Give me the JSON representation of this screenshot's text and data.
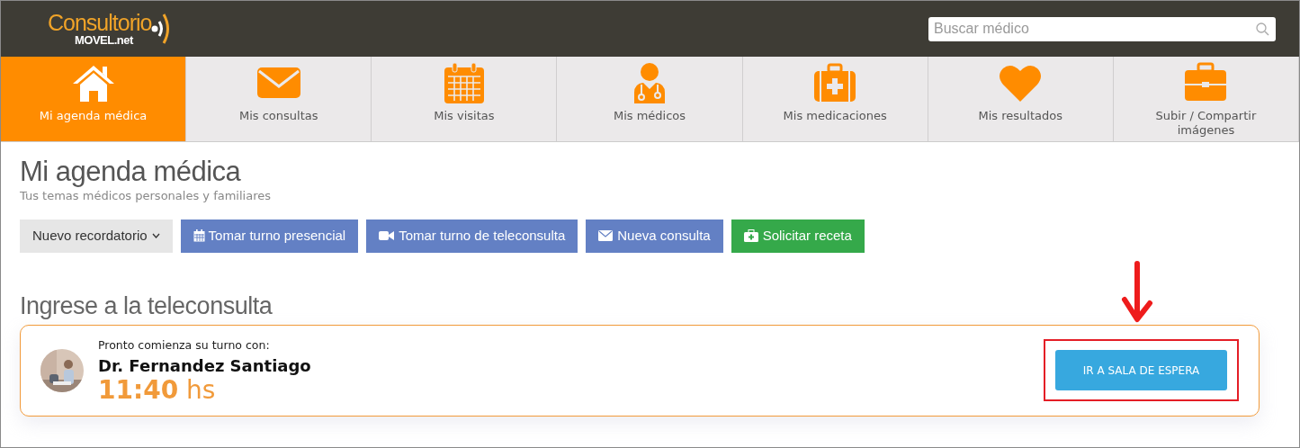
{
  "header": {
    "logo": {
      "name": "Consultorio",
      "domain": "MOVEL.net"
    },
    "search": {
      "placeholder": "Buscar médico"
    }
  },
  "nav": [
    {
      "label": "Mi agenda médica",
      "kind": "home",
      "selected": true
    },
    {
      "label": "Mis consultas",
      "kind": "envelope",
      "selected": false
    },
    {
      "label": "Mis visitas",
      "kind": "calendar",
      "selected": false
    },
    {
      "label": "Mis médicos",
      "kind": "doctor",
      "selected": false
    },
    {
      "label": "Mis medicaciones",
      "kind": "medkit",
      "selected": false
    },
    {
      "label": "Mis resultados",
      "kind": "heart",
      "selected": false
    },
    {
      "label": "Subir / Compartir imágenes",
      "kind": "briefcase",
      "selected": false
    }
  ],
  "page": {
    "title": "Mi agenda médica",
    "subtitle": "Tus temas médicos personales y familiares"
  },
  "actions": [
    {
      "label": "Nuevo recordatorio",
      "kind": "dropdown",
      "color": "#e6e6e6"
    },
    {
      "label": "Tomar turno presencial",
      "kind": "calendar",
      "color": "#6380c4"
    },
    {
      "label": "Tomar turno de teleconsulta",
      "kind": "video",
      "color": "#6380c4"
    },
    {
      "label": "Nueva consulta",
      "kind": "envelope",
      "color": "#6380c4"
    },
    {
      "label": "Solicitar receta",
      "kind": "medkit",
      "color": "#35a94a"
    }
  ],
  "teleconsulta": {
    "title": "Ingrese a la teleconsulta",
    "intro": "Pronto comienza su turno con:",
    "doctor": "Dr. Fernandez Santiago",
    "time": "**11:40** hs",
    "button": "IR A SALA DE ESPERA",
    "highlighted": true
  }
}
